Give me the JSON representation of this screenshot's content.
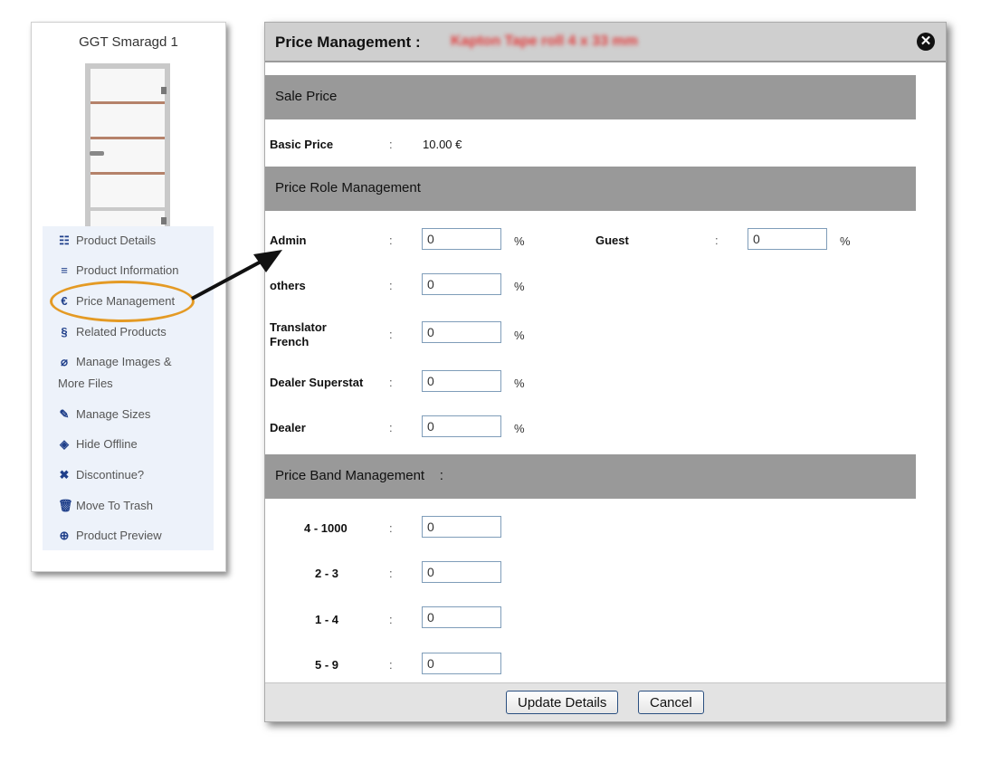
{
  "card": {
    "title": "GGT Smaragd 1",
    "menu": [
      {
        "icon": "list-icon",
        "glyph": "☷",
        "label": "Product Details"
      },
      {
        "icon": "lines-icon",
        "glyph": "≡",
        "label": "Product Information"
      },
      {
        "icon": "euro-icon",
        "glyph": "€",
        "label": "Price Management"
      },
      {
        "icon": "link-icon",
        "glyph": "§",
        "label": "Related Products"
      },
      {
        "icon": "paperclip-icon",
        "glyph": "⌀",
        "label": "Manage Images &",
        "label2": "More Files"
      },
      {
        "icon": "edit-icon",
        "glyph": "✎",
        "label": "Manage Sizes"
      },
      {
        "icon": "eye-slash-icon",
        "glyph": "◈",
        "label": "Hide Offline"
      },
      {
        "icon": "x-icon",
        "glyph": "✖",
        "label": "Discontinue?"
      },
      {
        "icon": "trash-icon",
        "glyph": "🗑",
        "label": "Move To Trash"
      },
      {
        "icon": "zoom-icon",
        "glyph": "⊕",
        "label": "Product Preview"
      }
    ]
  },
  "modal": {
    "title": "Price Management  :",
    "subtitle": "Kapton Tape roll 4 x 33 mm",
    "close_glyph": "✕",
    "sale_section": "Sale Price",
    "basic_price_label": "Basic Price",
    "basic_price_value": "10.00 €",
    "role_section": "Price Role Management",
    "roles": [
      {
        "label": "Admin",
        "value": "0"
      },
      {
        "label": "others",
        "value": "0"
      },
      {
        "label": "Translator",
        "label2": "French",
        "value": "0"
      },
      {
        "label": "Dealer Superstat",
        "value": "0"
      },
      {
        "label": "Dealer",
        "value": "0"
      }
    ],
    "guest": {
      "label": "Guest",
      "value": "0"
    },
    "colon": ":",
    "percent": "%",
    "band_section": "Price Band Management    :",
    "bands": [
      {
        "label": "4 - 1000",
        "value": "0"
      },
      {
        "label": "2 - 3",
        "value": "0"
      },
      {
        "label": "1 - 4",
        "value": "0"
      },
      {
        "label": "5 - 9",
        "value": "0"
      }
    ],
    "update_label": "Update Details",
    "cancel_label": "Cancel"
  },
  "colors": {
    "accent": "#e49a24",
    "icon": "#1f3f8a",
    "section": "#999999"
  }
}
